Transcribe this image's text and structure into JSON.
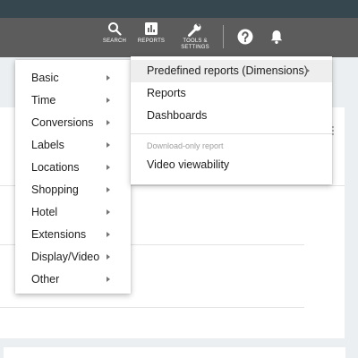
{
  "topbar": {
    "search_label": "SEARCH",
    "reports_label": "REPORTS",
    "tools_label_line1": "TOOLS &",
    "tools_label_line2": "SETTINGS",
    "icons": [
      "search-icon",
      "reports-icon",
      "wrench-icon",
      "help-icon",
      "bell-icon"
    ]
  },
  "left_menu": {
    "items": [
      {
        "label": "Basic"
      },
      {
        "label": "Time"
      },
      {
        "label": "Conversions"
      },
      {
        "label": "Labels"
      },
      {
        "label": "Locations"
      },
      {
        "label": "Shopping"
      },
      {
        "label": "Hotel"
      },
      {
        "label": "Extensions"
      },
      {
        "label": "Display/Video"
      },
      {
        "label": "Other"
      }
    ]
  },
  "right_menu": {
    "predefined": "Predefined reports (Dimensions)",
    "reports": "Reports",
    "dashboards": "Dashboards",
    "section_label": "Download-only report",
    "video_viewability": "Video viewability"
  },
  "colors": {
    "topbar": "#5c5c5c",
    "topstrip": "#37474f",
    "background": "#eceff1",
    "menu_bg": "#ffffff",
    "active_item_bg": "#eeeeee",
    "text": "#212121",
    "muted_text": "#9e9e9e"
  }
}
